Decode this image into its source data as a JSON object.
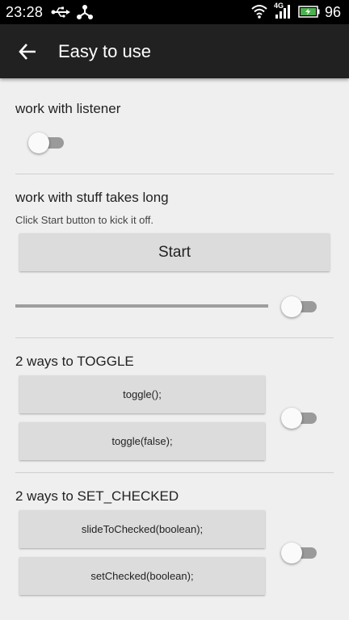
{
  "status_bar": {
    "time": "23:28",
    "battery_percent": "96",
    "network_type": "4G",
    "icons": [
      "usb-icon",
      "share-icon",
      "wifi-icon",
      "signal-icon",
      "battery-icon"
    ],
    "battery_color": "#4caf50"
  },
  "app_bar": {
    "title": "Easy to use",
    "back_icon": "arrow-left-icon",
    "background": "#212121"
  },
  "section_listener": {
    "title": "work with listener",
    "switch_checked": false
  },
  "section_long": {
    "title": "work with stuff takes long",
    "hint": "Click Start button to kick it off.",
    "start_label": "Start",
    "progress": 0,
    "switch_checked": false
  },
  "section_toggle": {
    "title": "2 ways to TOGGLE",
    "button1_label": "toggle();",
    "button2_label": "toggle(false);",
    "switch_checked": false
  },
  "section_set_checked": {
    "title": "2 ways to SET_CHECKED",
    "button1_label": "slideToChecked(boolean);",
    "button2_label": "setChecked(boolean);",
    "switch_checked": false
  }
}
